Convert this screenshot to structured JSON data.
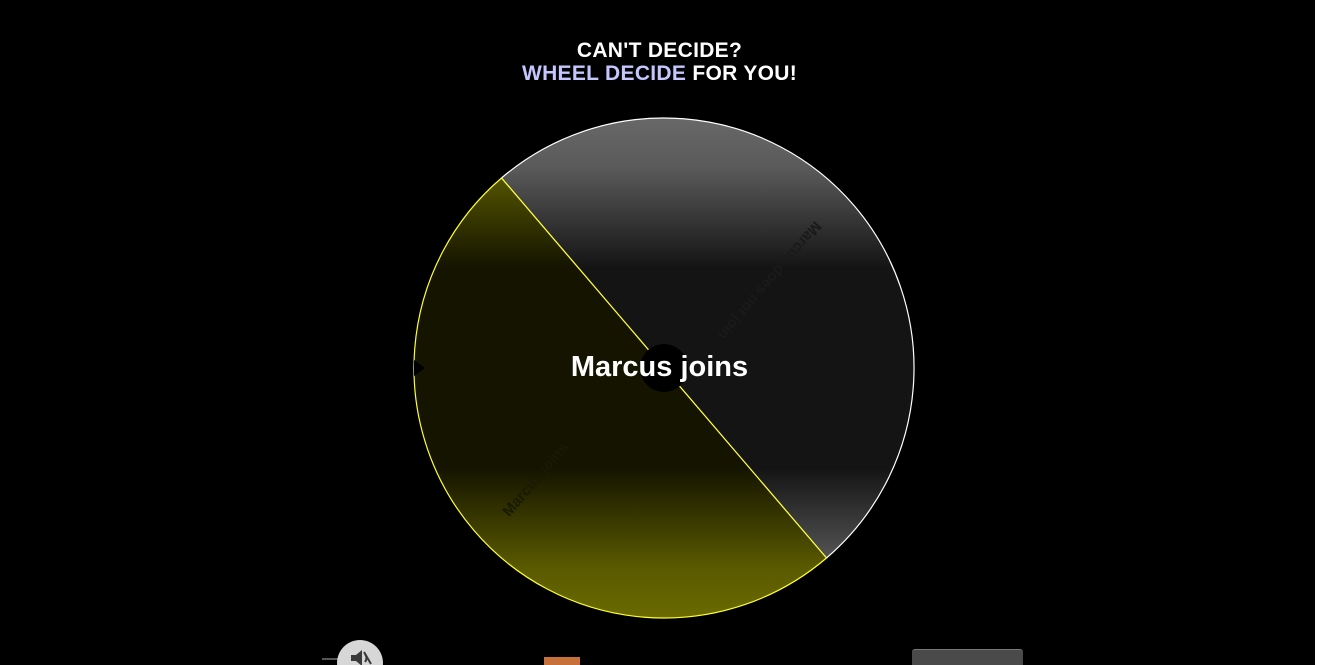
{
  "header": {
    "line1": "CAN'T DECIDE?",
    "line2_accent": "WHEEL DECIDE",
    "line2_rest": " FOR YOU!"
  },
  "wheel": {
    "segments": [
      {
        "label": "Marcus does not join",
        "color": "#666666"
      },
      {
        "label": "Marcus joins",
        "color": "#666600"
      }
    ],
    "result": "Marcus joins"
  },
  "controls": {
    "sound_icon": "speaker-icon"
  },
  "colors": {
    "background": "#000000",
    "accent": "#c6c6ff",
    "segment_grey": "#666666",
    "segment_olive": "#666600"
  }
}
